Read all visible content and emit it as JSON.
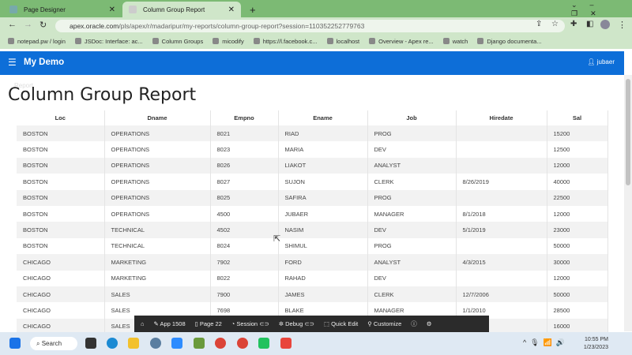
{
  "browser": {
    "tabs": [
      {
        "label": "Page Designer",
        "active": false
      },
      {
        "label": "Column Group Report",
        "active": true
      }
    ],
    "new_tab": "+",
    "url_host": "apex.oracle.com",
    "url_path": "/pls/apex/r/madaripur/my-reports/column-group-report?session=110352252779763",
    "bookmarks": [
      "notepad.pw / login",
      "JSDoc: Interface: ac...",
      "Column Groups",
      "micodify",
      "https://l.facebook.c...",
      "localhost",
      "Overview - Apex re...",
      "watch",
      "Django documenta..."
    ]
  },
  "app": {
    "name": "My Demo",
    "user": "jubaer",
    "breadcrumb": "Report",
    "page_title": "Column Group Report"
  },
  "table": {
    "columns": [
      "Loc",
      "Dname",
      "Empno",
      "Ename",
      "Job",
      "Hiredate",
      "Sal"
    ],
    "rows": [
      [
        "BOSTON",
        "OPERATIONS",
        "8021",
        "RIAD",
        "PROG",
        "",
        "15200"
      ],
      [
        "BOSTON",
        "OPERATIONS",
        "8023",
        "MARIA",
        "DEV",
        "",
        "12500"
      ],
      [
        "BOSTON",
        "OPERATIONS",
        "8026",
        "LIAKOT",
        "ANALYST",
        "",
        "12000"
      ],
      [
        "BOSTON",
        "OPERATIONS",
        "8027",
        "SUJON",
        "CLERK",
        "8/26/2019",
        "40000"
      ],
      [
        "BOSTON",
        "OPERATIONS",
        "8025",
        "SAFIRA",
        "PROG",
        "",
        "22500"
      ],
      [
        "BOSTON",
        "OPERATIONS",
        "4500",
        "JUBAER",
        "MANAGER",
        "8/1/2018",
        "12000"
      ],
      [
        "BOSTON",
        "TECHNICAL",
        "4502",
        "NASIM",
        "DEV",
        "5/1/2019",
        "23000"
      ],
      [
        "BOSTON",
        "TECHNICAL",
        "8024",
        "SHIMUL",
        "PROG",
        "",
        "50000"
      ],
      [
        "CHICAGO",
        "MARKETING",
        "7902",
        "FORD",
        "ANALYST",
        "4/3/2015",
        "30000"
      ],
      [
        "CHICAGO",
        "MARKETING",
        "8022",
        "RAHAD",
        "DEV",
        "",
        "12000"
      ],
      [
        "CHICAGO",
        "SALES",
        "7900",
        "JAMES",
        "CLERK",
        "12/7/2006",
        "50000"
      ],
      [
        "CHICAGO",
        "SALES",
        "7698",
        "BLAKE",
        "MANAGER",
        "1/1/2010",
        "28500"
      ],
      [
        "CHICAGO",
        "SALES",
        "",
        "",
        "",
        "",
        "16000"
      ]
    ]
  },
  "devbar": {
    "app": "App 1508",
    "page": "Page 22",
    "session": "Session",
    "debug": "Debug",
    "quick_edit": "Quick Edit",
    "customize": "Customize"
  },
  "taskbar": {
    "search": "Search",
    "time": "10:55 PM",
    "date": "1/23/2023"
  }
}
